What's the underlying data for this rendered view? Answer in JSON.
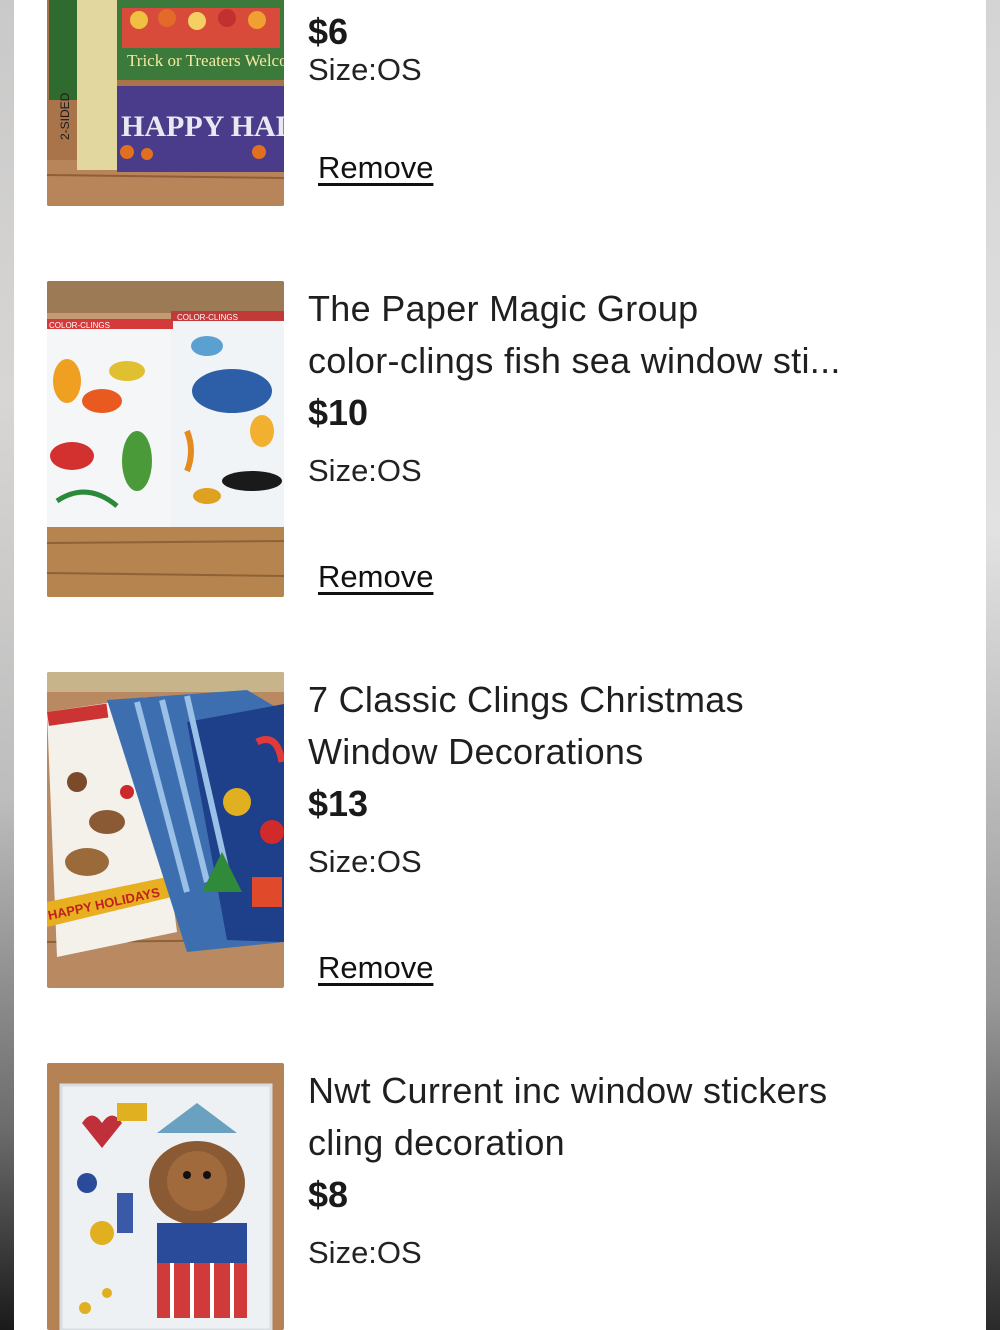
{
  "items": [
    {
      "title": "",
      "price": "$6",
      "size_label": "Size:",
      "size_value": "OS",
      "remove_label": "Remove",
      "thumb_text": [
        "Trick or Treaters Welcome",
        "2-SIDED",
        "HAPPY HALLOWEEN"
      ]
    },
    {
      "title_line1": "The Paper Magic Group",
      "title_line2": "color-clings fish sea window sti...",
      "price": "$10",
      "size_label": "Size:",
      "size_value": "OS",
      "remove_label": "Remove",
      "thumb_text": [
        "COLOR-CLINGS",
        "COLOR-CLINGS"
      ]
    },
    {
      "title_line1": "7 Classic Clings Christmas",
      "title_line2": "Window Decorations",
      "price": "$13",
      "size_label": "Size:",
      "size_value": "OS",
      "remove_label": "Remove",
      "thumb_text": [
        "HAPPY HOLIDAYS"
      ]
    },
    {
      "title_line1": "Nwt Current inc window stickers",
      "title_line2": "cling decoration",
      "price": "$8",
      "size_label": "Size:",
      "size_value": "OS"
    }
  ],
  "colors": {
    "text": "#1f1f1f",
    "background": "#ffffff",
    "floor_wood": "#b07a4e"
  }
}
